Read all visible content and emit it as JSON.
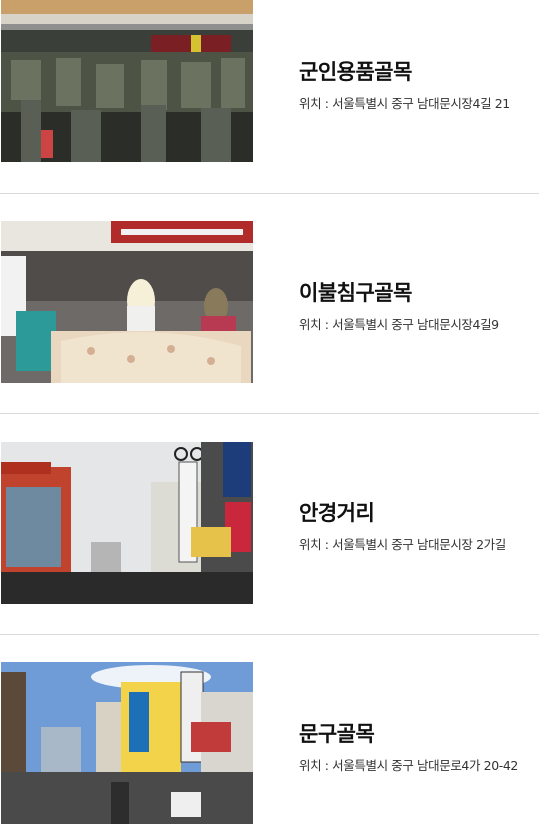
{
  "location_label": "위치 :",
  "alleys": [
    {
      "name": "군인용품골목",
      "address": "서울특별시 중구 남대문시장4길 21",
      "photo_icon": "military-goods-market-photo"
    },
    {
      "name": "이불침구골목",
      "address": "서울특별시 중구 남대문시장4길9",
      "photo_icon": "bedding-market-photo"
    },
    {
      "name": "안경거리",
      "address": "서울특별시 중구 남대문시장 2가길",
      "photo_icon": "eyeglasses-street-photo"
    },
    {
      "name": "문구골목",
      "address": "서울특별시 중구 남대문로4가 20-42",
      "photo_icon": "stationery-alley-photo"
    }
  ]
}
